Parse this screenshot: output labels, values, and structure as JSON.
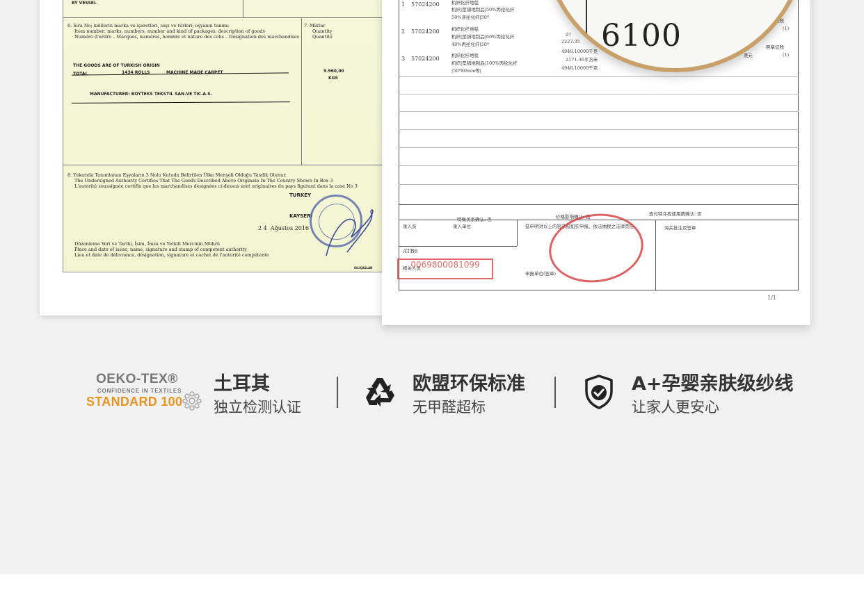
{
  "certificate": {
    "by_vessel": "BY VESSEL",
    "box6_lines": [
      "6. Sıra No; kolilerin marka ve işaretleri, sayı ve türleri; eşyanın tanımı",
      "Item number; marks, numbers, number and kind of packages; description of goods",
      "Numéro d'ordre – Marques, numéros, nombre et nature des colis – Désignation des marchandises"
    ],
    "box7_lines": [
      "7. Miktar",
      "Quantity",
      "Quantité"
    ],
    "goods_origin": "THE GOODS ARE OF TURKISH ORIGIN",
    "total": "TOTAL",
    "rolls": "1434 ROLLS",
    "carpet": "MACHINE MADE CARPET",
    "qty_value": "9.960,00",
    "qty_unit": "KGS",
    "manufacturer": "MANUFACTURER: BOYTEKS TEKSTIL SAN.VE TIC.A.S.",
    "box8_lines": [
      "8. Yukarıda Tanımlanan Eşyaların 3 Nolu Kutuda Belirtilen Ülke Menşeli Olduğu Tasdik Olunur.",
      "The Undersigned Authority Certifies That The Goods Described Above Originate In The Country Shown In Box 3",
      "L'autorité soussignée certifie que les marchandises désignées ci-dessus sont originaires du pays figurant dans la case No 3"
    ],
    "country": "TURKEY",
    "city": "KAYSERİ",
    "date": "2 4  Ağustos 2016",
    "place_lines": [
      "Düzenleme Yeri ve Tarihi, İsim, İmza ve Yetkili Mercinin Mührü",
      "Place and date of issue, name, signature and stamp of competent authority",
      "Lieu et date de délivrance, désignation, signature et cachet de l'autorité compétente"
    ],
    "printer": "KILIÇASLAN"
  },
  "customs": {
    "rows": [
      {
        "no": "1",
        "code": "57024200",
        "desc": [
          "机织化纤地毯",
          "机织|是铺地制品|50%丙纶化纤",
          "50%涤纶化纤|50*"
        ]
      },
      {
        "no": "2",
        "code": "57024200",
        "desc": [
          "机织化纤地毯",
          "机织|是铺地制品|60%丙纶化纤",
          "40%丙纶化纤|50*"
        ]
      },
      {
        "no": "3",
        "code": "57024200",
        "desc": [
          "机织化纤地毯",
          "机织|是铺地制品|100%丙纶化纤",
          "|50*80mm等|"
        ]
      }
    ],
    "right_col": [
      "照章征税",
      "(1)",
      "照章征税",
      "(1)"
    ],
    "qty_col": [
      "97",
      "2227.35",
      "4948.10000千克",
      "2171.36平方米",
      "4948.10000千克"
    ],
    "yuan": "美元",
    "special_relation": "特殊关系确认: 否",
    "price_impact": "价格影响确认: 否",
    "royalty": "支付特许权使用费确认: 否",
    "entry_person": "录入员",
    "entry_unit": "录入单位",
    "declare_text": "兹申明对以上内容承担如实申报、依法纳税之法律责任",
    "customs_notes": "海关批注及签章",
    "atb": "ATB6",
    "declarer": "报关人员",
    "declare_unit": "申报单位(签章)",
    "red_code": "0069800081099",
    "page": "1/1",
    "magnified": "6100"
  },
  "features": [
    {
      "logo": {
        "line1": "OEKO-TEX®",
        "line2": "CONFIDENCE IN TEXTILES",
        "line3": "STANDARD 100"
      },
      "title": "土耳其",
      "subtitle": "独立检测认证",
      "icon": "oeko-tex-logo"
    },
    {
      "title": "欧盟环保标准",
      "subtitle": "无甲醛超标",
      "icon": "recycle-icon"
    },
    {
      "title": "A+孕婴亲肤级纱线",
      "subtitle": "让家人更安心",
      "icon": "shield-check-icon"
    }
  ],
  "colors": {
    "oeko_orange": "#e89422",
    "stamp_red": "#d43b3b",
    "stamp_blue": "#4a5fa8",
    "magnifier_gold": "#c9a06a"
  }
}
